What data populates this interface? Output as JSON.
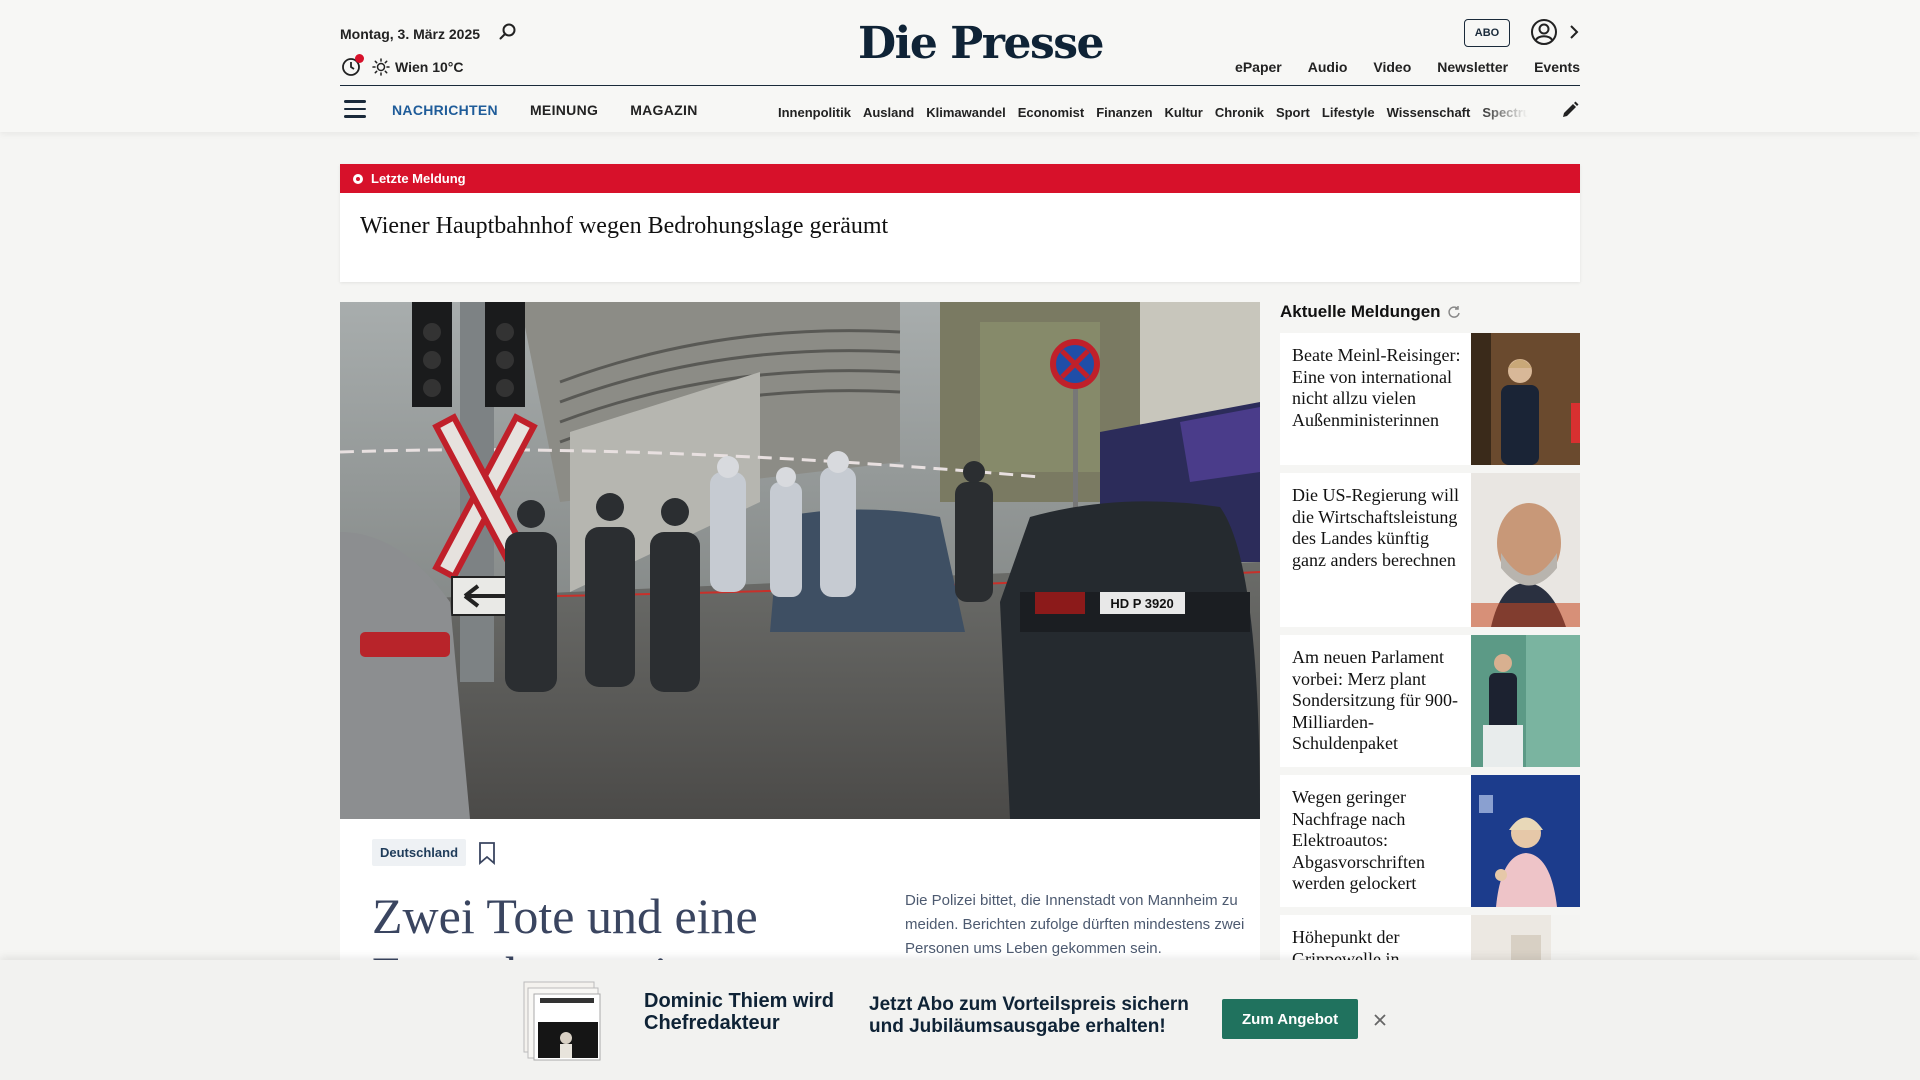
{
  "header": {
    "date": "Montag, 3. März 2025",
    "weather": "Wien 10°C",
    "logo": "Die Presse",
    "abo_label": "ABO",
    "top_links": [
      "ePaper",
      "Audio",
      "Video",
      "Newsletter",
      "Events"
    ],
    "main_nav": [
      {
        "label": "NACHRICHTEN",
        "active": true
      },
      {
        "label": "MEINUNG",
        "active": false
      },
      {
        "label": "MAGAZIN",
        "active": false
      }
    ],
    "sub_nav": [
      "Innenpolitik",
      "Ausland",
      "Klimawandel",
      "Economist",
      "Finanzen",
      "Kultur",
      "Chronik",
      "Sport",
      "Lifestyle",
      "Wissenschaft",
      "Spectrum"
    ]
  },
  "breaking": {
    "label": "Letzte Meldung",
    "headline": "Wiener Hauptbahnhof wegen Bedrohungslage geräumt"
  },
  "hero": {
    "tag": "Deutschland",
    "title": "Zwei Tote und eine Fernsehszene in Mannheim",
    "teaser": "Die Polizei bittet, die Innenstadt von Mannheim zu meiden. Berichten zufolge dürften mindestens zwei Personen ums Leben gekommen sein.",
    "image_plate": "HD P 3920"
  },
  "sidebar": {
    "title": "Aktuelle Meldungen",
    "items": [
      {
        "headline": "Beate Meinl-Reisinger: Eine von international nicht allzu vielen Außenministerinnen"
      },
      {
        "headline": "Die US-Regierung will die Wirtschaftsleistung des Landes künftig ganz anders berechnen"
      },
      {
        "headline": "Am neuen Parlament vorbei: Merz plant Sondersitzung für 900-Milliarden-Schuldenpaket"
      },
      {
        "headline": "Wegen geringer Nachfrage nach Elektroautos: Abgasvorschriften werden gelockert"
      },
      {
        "headline": "Höhepunkt der Grippewelle in"
      }
    ]
  },
  "promo": {
    "name": "Dominic Thiem wird Chefredakteur",
    "text": "Jetzt Abo zum Vorteilspreis sichern und Jubiläumsausgabe erhalten!",
    "button": "Zum Angebot"
  },
  "colors": {
    "brand_navy": "#0f2336",
    "breaking_red": "#d7112a",
    "nav_active": "#1f5c99",
    "cta_green": "#20725e"
  }
}
